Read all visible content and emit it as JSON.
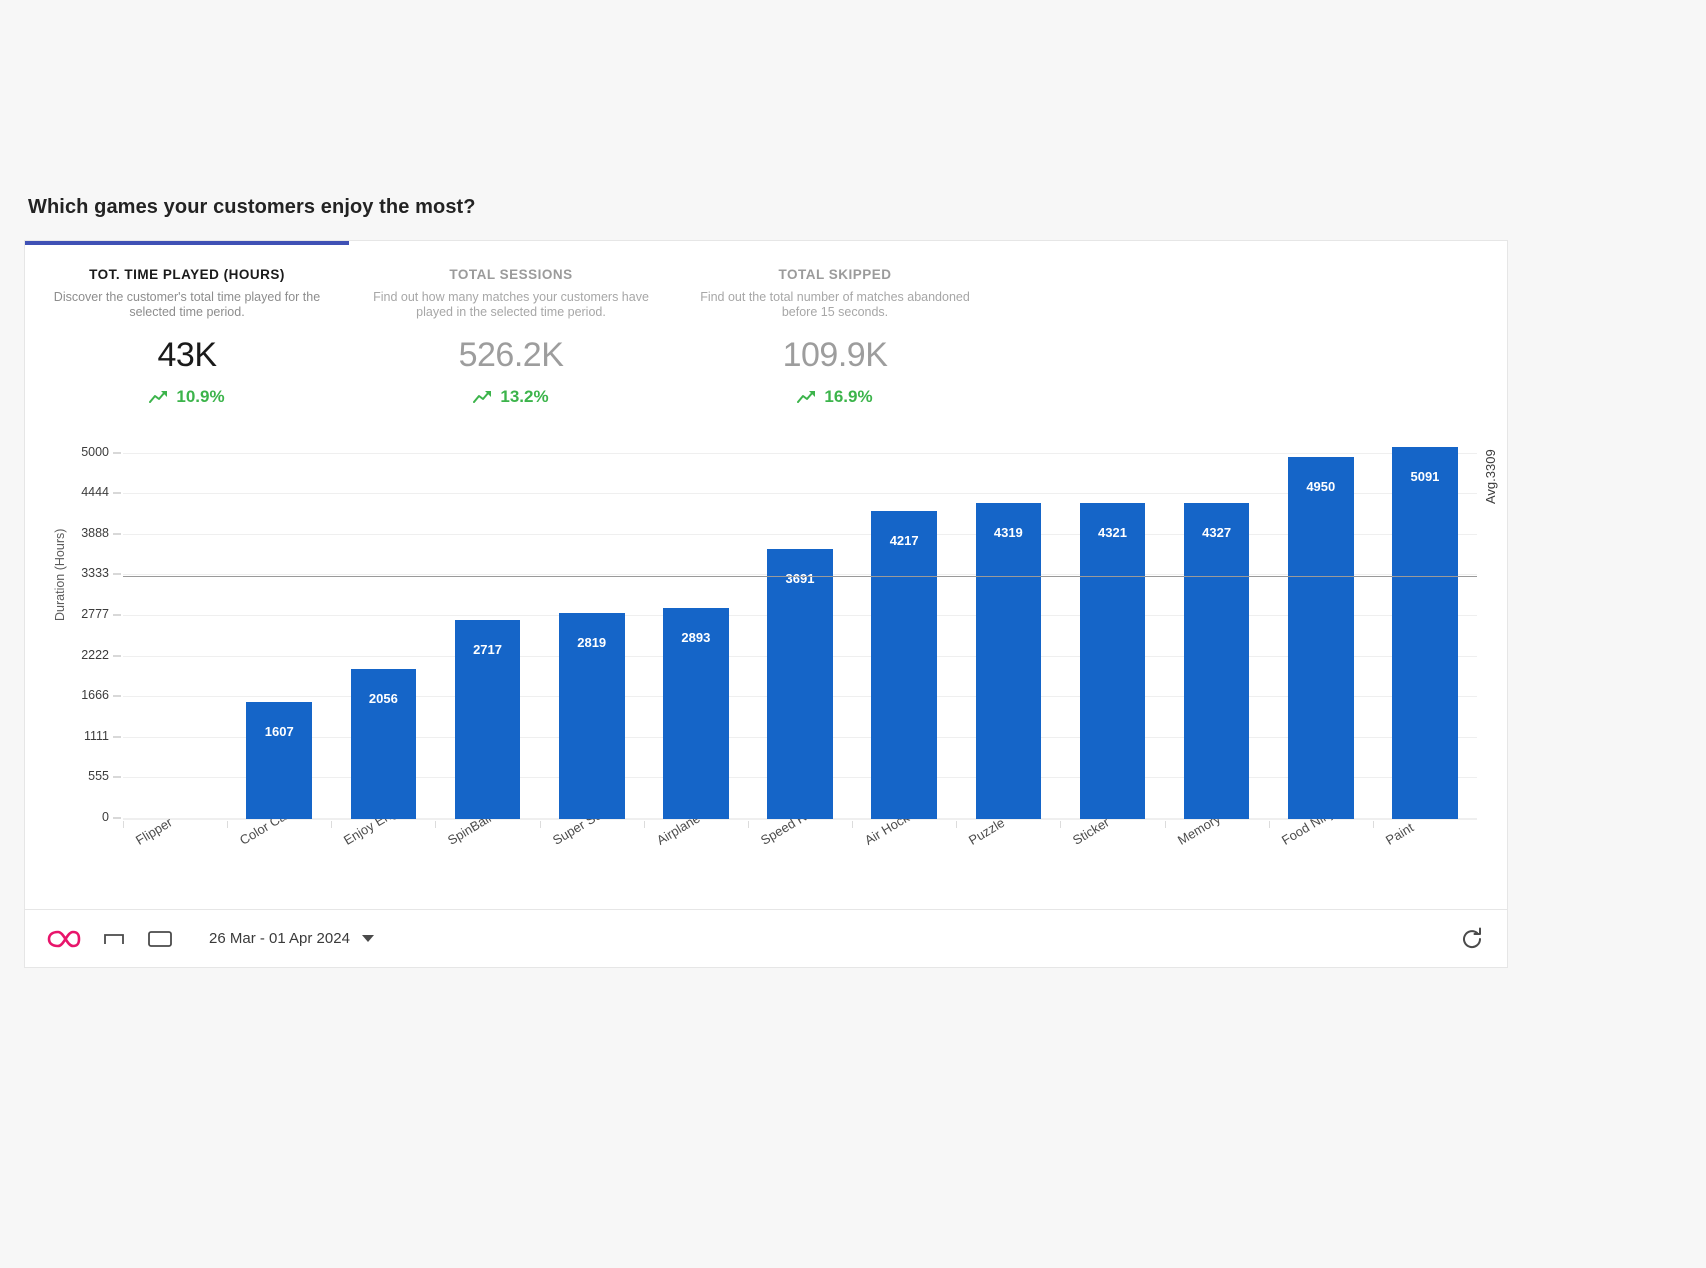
{
  "page_title": "Which games your customers enjoy the most?",
  "kpis": [
    {
      "title": "TOT. TIME PLAYED (HOURS)",
      "description": "Discover the customer's total time played for the selected time period.",
      "value": "43K",
      "trend": "10.9%",
      "trend_icon": "trend-up-icon",
      "active": true
    },
    {
      "title": "TOTAL SESSIONS",
      "description": "Find out how many matches your customers have played in the selected time period.",
      "value": "526.2K",
      "trend": "13.2%",
      "trend_icon": "trend-up-icon",
      "active": false
    },
    {
      "title": "TOTAL SKIPPED",
      "description": "Find out the total number of matches abandoned before 15 seconds.",
      "value": "109.9K",
      "trend": "16.9%",
      "trend_icon": "trend-up-icon",
      "active": false
    }
  ],
  "chart_data": {
    "type": "bar",
    "title": "",
    "xlabel": "",
    "ylabel": "Duration (Hours)",
    "categories": [
      "Flipper",
      "Color Catcher",
      "Enjoy English",
      "SpinBall",
      "Super Soccer",
      "Airplane Toss",
      "Speed Racer",
      "Air Hockey",
      "Puzzle",
      "Sticker",
      "Memory",
      "Food Ninja",
      "Paint"
    ],
    "values": [
      0,
      1607,
      2056,
      2717,
      2819,
      2893,
      3691,
      4217,
      4319,
      4321,
      4327,
      4950,
      5091
    ],
    "value_labels": [
      "",
      "1607",
      "2056",
      "2717",
      "2819",
      "2893",
      "3691",
      "4217",
      "4319",
      "4321",
      "4327",
      "4950",
      "5091"
    ],
    "ylim": [
      0,
      5200
    ],
    "yticks": [
      5000,
      4444,
      3888,
      3333,
      2777,
      2222,
      1666,
      1111,
      555,
      0
    ],
    "ytick_labels": [
      "5000",
      "4444",
      "3888",
      "3333",
      "2777",
      "2222",
      "1666",
      "1111",
      "555",
      "0"
    ],
    "grid": true,
    "legend": "none",
    "average": 3309,
    "average_label": "Avg.3309",
    "bar_color": "#1565c8",
    "average_line_color": "#9a9a9a"
  },
  "footer": {
    "logo_icon": "infinity-logo-icon",
    "bracket_icon": "bracket-icon",
    "window_icon": "window-icon",
    "date_range": "26 Mar - 01 Apr 2024",
    "caret_icon": "chevron-down-icon",
    "refresh_icon": "refresh-icon"
  },
  "colors": {
    "accent": "#3f51b5",
    "bar": "#1565c8",
    "positive": "#3cb44b",
    "logo": "#e8156b"
  }
}
